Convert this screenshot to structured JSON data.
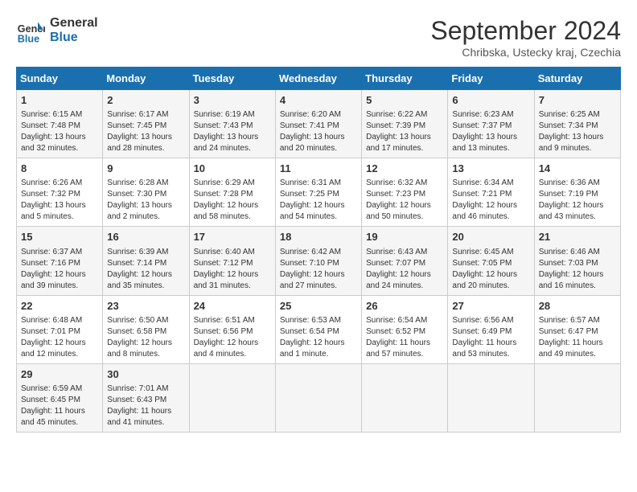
{
  "header": {
    "logo_text_general": "General",
    "logo_text_blue": "Blue",
    "month_title": "September 2024",
    "subtitle": "Chribska, Ustecky kraj, Czechia"
  },
  "days_of_week": [
    "Sunday",
    "Monday",
    "Tuesday",
    "Wednesday",
    "Thursday",
    "Friday",
    "Saturday"
  ],
  "weeks": [
    [
      {
        "day": "1",
        "info": "Sunrise: 6:15 AM\nSunset: 7:48 PM\nDaylight: 13 hours\nand 32 minutes."
      },
      {
        "day": "2",
        "info": "Sunrise: 6:17 AM\nSunset: 7:45 PM\nDaylight: 13 hours\nand 28 minutes."
      },
      {
        "day": "3",
        "info": "Sunrise: 6:19 AM\nSunset: 7:43 PM\nDaylight: 13 hours\nand 24 minutes."
      },
      {
        "day": "4",
        "info": "Sunrise: 6:20 AM\nSunset: 7:41 PM\nDaylight: 13 hours\nand 20 minutes."
      },
      {
        "day": "5",
        "info": "Sunrise: 6:22 AM\nSunset: 7:39 PM\nDaylight: 13 hours\nand 17 minutes."
      },
      {
        "day": "6",
        "info": "Sunrise: 6:23 AM\nSunset: 7:37 PM\nDaylight: 13 hours\nand 13 minutes."
      },
      {
        "day": "7",
        "info": "Sunrise: 6:25 AM\nSunset: 7:34 PM\nDaylight: 13 hours\nand 9 minutes."
      }
    ],
    [
      {
        "day": "8",
        "info": "Sunrise: 6:26 AM\nSunset: 7:32 PM\nDaylight: 13 hours\nand 5 minutes."
      },
      {
        "day": "9",
        "info": "Sunrise: 6:28 AM\nSunset: 7:30 PM\nDaylight: 13 hours\nand 2 minutes."
      },
      {
        "day": "10",
        "info": "Sunrise: 6:29 AM\nSunset: 7:28 PM\nDaylight: 12 hours\nand 58 minutes."
      },
      {
        "day": "11",
        "info": "Sunrise: 6:31 AM\nSunset: 7:25 PM\nDaylight: 12 hours\nand 54 minutes."
      },
      {
        "day": "12",
        "info": "Sunrise: 6:32 AM\nSunset: 7:23 PM\nDaylight: 12 hours\nand 50 minutes."
      },
      {
        "day": "13",
        "info": "Sunrise: 6:34 AM\nSunset: 7:21 PM\nDaylight: 12 hours\nand 46 minutes."
      },
      {
        "day": "14",
        "info": "Sunrise: 6:36 AM\nSunset: 7:19 PM\nDaylight: 12 hours\nand 43 minutes."
      }
    ],
    [
      {
        "day": "15",
        "info": "Sunrise: 6:37 AM\nSunset: 7:16 PM\nDaylight: 12 hours\nand 39 minutes."
      },
      {
        "day": "16",
        "info": "Sunrise: 6:39 AM\nSunset: 7:14 PM\nDaylight: 12 hours\nand 35 minutes."
      },
      {
        "day": "17",
        "info": "Sunrise: 6:40 AM\nSunset: 7:12 PM\nDaylight: 12 hours\nand 31 minutes."
      },
      {
        "day": "18",
        "info": "Sunrise: 6:42 AM\nSunset: 7:10 PM\nDaylight: 12 hours\nand 27 minutes."
      },
      {
        "day": "19",
        "info": "Sunrise: 6:43 AM\nSunset: 7:07 PM\nDaylight: 12 hours\nand 24 minutes."
      },
      {
        "day": "20",
        "info": "Sunrise: 6:45 AM\nSunset: 7:05 PM\nDaylight: 12 hours\nand 20 minutes."
      },
      {
        "day": "21",
        "info": "Sunrise: 6:46 AM\nSunset: 7:03 PM\nDaylight: 12 hours\nand 16 minutes."
      }
    ],
    [
      {
        "day": "22",
        "info": "Sunrise: 6:48 AM\nSunset: 7:01 PM\nDaylight: 12 hours\nand 12 minutes."
      },
      {
        "day": "23",
        "info": "Sunrise: 6:50 AM\nSunset: 6:58 PM\nDaylight: 12 hours\nand 8 minutes."
      },
      {
        "day": "24",
        "info": "Sunrise: 6:51 AM\nSunset: 6:56 PM\nDaylight: 12 hours\nand 4 minutes."
      },
      {
        "day": "25",
        "info": "Sunrise: 6:53 AM\nSunset: 6:54 PM\nDaylight: 12 hours\nand 1 minute."
      },
      {
        "day": "26",
        "info": "Sunrise: 6:54 AM\nSunset: 6:52 PM\nDaylight: 11 hours\nand 57 minutes."
      },
      {
        "day": "27",
        "info": "Sunrise: 6:56 AM\nSunset: 6:49 PM\nDaylight: 11 hours\nand 53 minutes."
      },
      {
        "day": "28",
        "info": "Sunrise: 6:57 AM\nSunset: 6:47 PM\nDaylight: 11 hours\nand 49 minutes."
      }
    ],
    [
      {
        "day": "29",
        "info": "Sunrise: 6:59 AM\nSunset: 6:45 PM\nDaylight: 11 hours\nand 45 minutes."
      },
      {
        "day": "30",
        "info": "Sunrise: 7:01 AM\nSunset: 6:43 PM\nDaylight: 11 hours\nand 41 minutes."
      },
      {
        "day": "",
        "info": ""
      },
      {
        "day": "",
        "info": ""
      },
      {
        "day": "",
        "info": ""
      },
      {
        "day": "",
        "info": ""
      },
      {
        "day": "",
        "info": ""
      }
    ]
  ]
}
